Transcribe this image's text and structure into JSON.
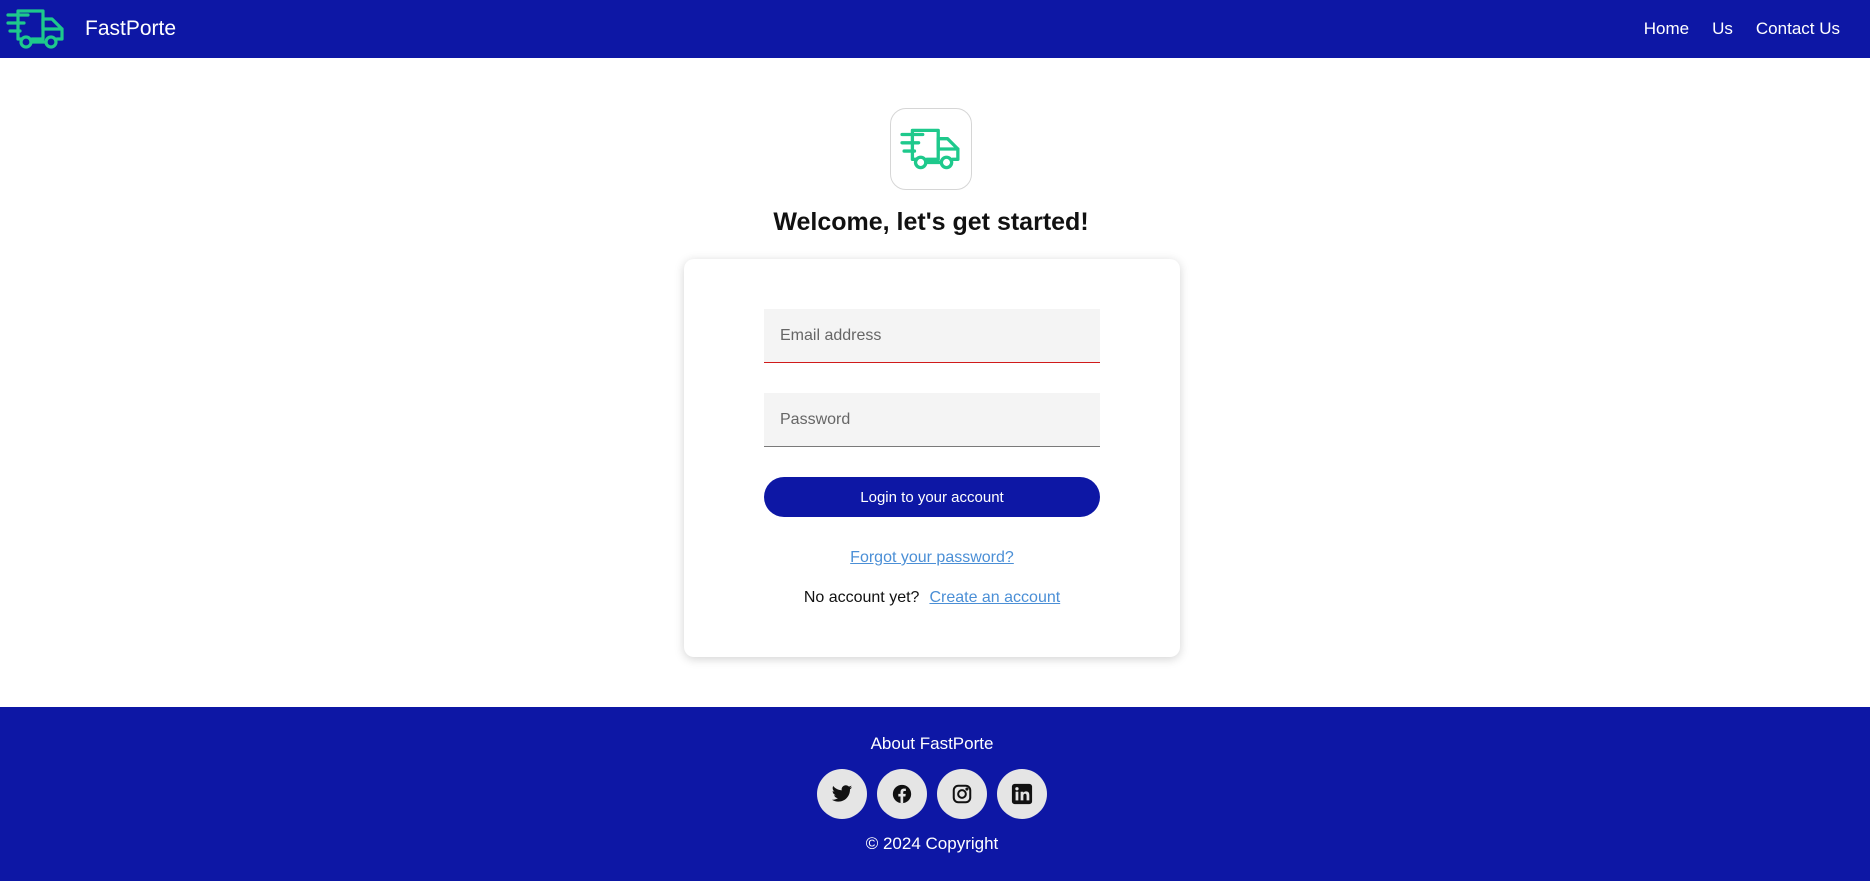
{
  "header": {
    "brand_name": "FastPorte",
    "nav": [
      {
        "label": "Home"
      },
      {
        "label": "Us"
      },
      {
        "label": "Contact Us"
      }
    ]
  },
  "login": {
    "heading": "Welcome, let's get started!",
    "email_placeholder": "Email address",
    "email_value": "",
    "password_placeholder": "Password",
    "password_value": "",
    "submit_label": "Login to your account",
    "forgot_label": "Forgot your password?",
    "no_account_text": "No account yet?",
    "create_account_label": "Create an account"
  },
  "footer": {
    "about_label": "About FastPorte",
    "socials": [
      {
        "icon": "twitter-icon"
      },
      {
        "icon": "facebook-icon"
      },
      {
        "icon": "instagram-icon"
      },
      {
        "icon": "linkedin-icon"
      }
    ],
    "copyright": "© 2024 Copyright"
  },
  "colors": {
    "brand_blue": "#0d17a5",
    "truck_green": "#1ec98c",
    "link_blue": "#4b8fd6",
    "email_underline": "#d01a1a"
  }
}
